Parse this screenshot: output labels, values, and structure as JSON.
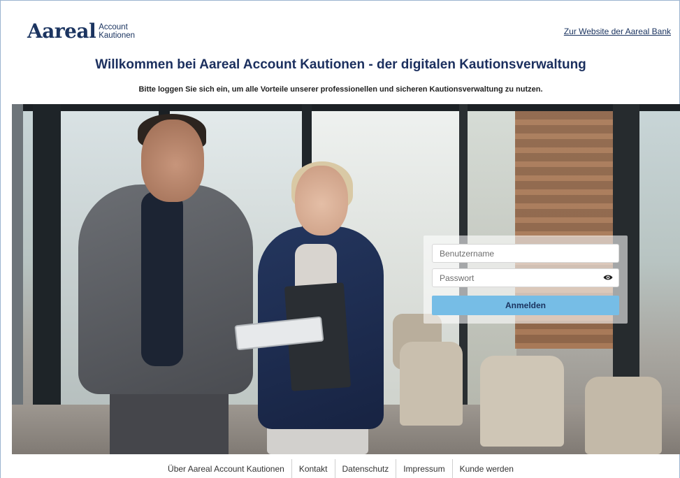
{
  "header": {
    "logo_main": "Aareal",
    "logo_sub_line1": "Account",
    "logo_sub_line2": "Kautionen",
    "bank_link": "Zur Website der Aareal Bank"
  },
  "hero_text": {
    "headline": "Willkommen bei Aareal Account Kautionen - der digitalen Kautionsverwaltung",
    "subline": "Bitte loggen Sie sich ein, um alle Vorteile unserer professionellen und sicheren Kautionsverwaltung zu nutzen."
  },
  "login": {
    "username_placeholder": "Benutzername",
    "password_placeholder": "Passwort",
    "submit_label": "Anmelden",
    "password_toggle_icon": "eye-icon"
  },
  "footer": {
    "links": [
      "Über Aareal Account Kautionen",
      "Kontakt",
      "Datenschutz",
      "Impressum",
      "Kunde werden"
    ]
  },
  "colors": {
    "brand_navy": "#1b3460",
    "button_blue": "#76bde6"
  }
}
